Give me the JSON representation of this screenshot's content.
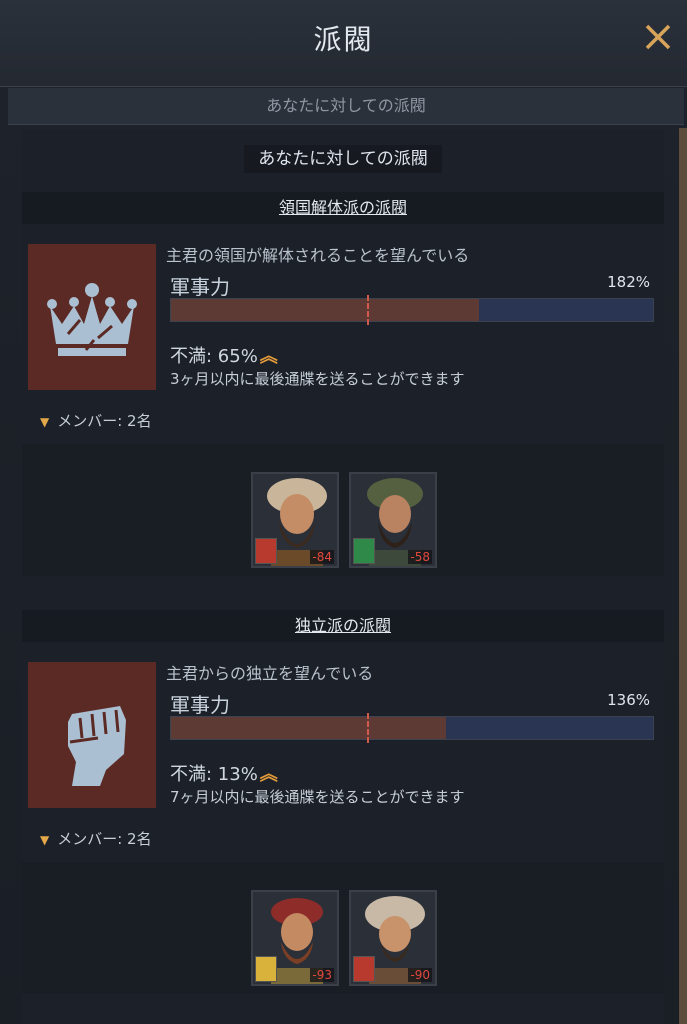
{
  "window": {
    "title": "派閥",
    "subheader": "あなたに対しての派閥",
    "section_title": "あなたに対しての派閥"
  },
  "factions": [
    {
      "name": "領国解体派の派閥",
      "emblem_icon": "crown-icon",
      "description": "主君の領国が解体されることを望んでいる",
      "military_label": "軍事力",
      "military_percent": "182%",
      "military_fill_fraction": 0.64,
      "discontent": "不満: 65%",
      "ultimatum": "3ヶ月以内に最後通牒を送ることができます",
      "members_label": "メンバー: 2名",
      "members": [
        {
          "opinion": "-84",
          "badge_color": "#b83a2e"
        },
        {
          "opinion": "-58",
          "badge_color": "#2f8a49"
        }
      ]
    },
    {
      "name": "独立派の派閥",
      "emblem_icon": "raised-fist-icon",
      "description": "主君からの独立を望んでいる",
      "military_label": "軍事力",
      "military_percent": "136%",
      "military_fill_fraction": 0.57,
      "discontent": "不満: 13%",
      "ultimatum": "7ヶ月以内に最後通牒を送ることができます",
      "members_label": "メンバー: 2名",
      "members": [
        {
          "opinion": "-93",
          "badge_color": "#d8b23a"
        },
        {
          "opinion": "-90",
          "badge_color": "#b83a2e"
        }
      ]
    }
  ]
}
